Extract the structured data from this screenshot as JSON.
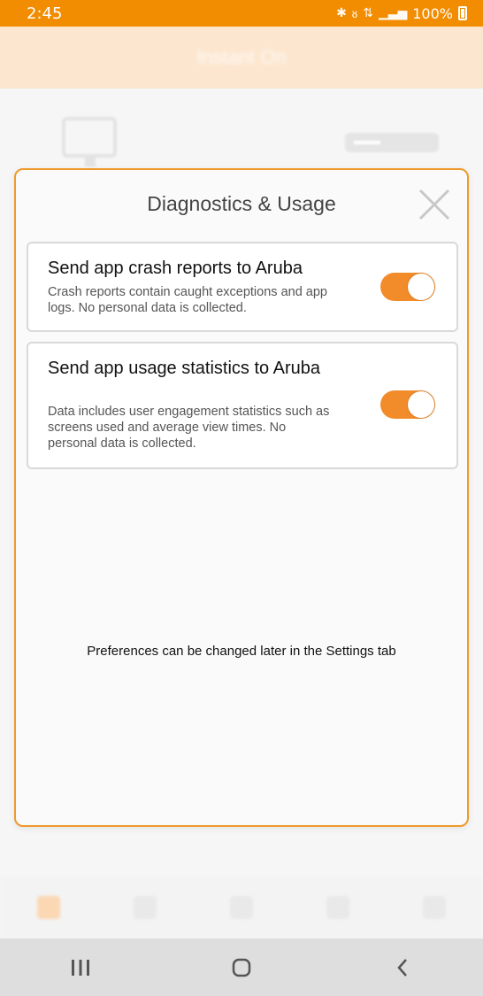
{
  "status_bar": {
    "time": "2:45",
    "battery_text": "100%",
    "icons": [
      "bluetooth-icon",
      "mute-icon",
      "data-icon",
      "signal-icon",
      "battery-icon"
    ]
  },
  "background_app": {
    "header_title": "Instant On",
    "accent": "#f28c00"
  },
  "modal": {
    "title": "Diagnostics & Usage",
    "close_icon": "close-icon",
    "options": [
      {
        "title": "Send app crash reports to Aruba",
        "description": "Crash reports contain caught exceptions and app logs. No personal data is collected.",
        "enabled": true
      },
      {
        "title": "Send app usage statistics to Aruba",
        "description": "Data includes user engagement statistics such as screens used and average view times. No personal data is collected.",
        "enabled": true
      }
    ],
    "footer_note": "Preferences can be changed later in the Settings tab"
  },
  "nav_bar": {
    "buttons": [
      "recents-icon",
      "home-icon",
      "back-icon"
    ]
  },
  "colors": {
    "status_bar": "#f28c00",
    "toggle_on": "#f28c2a",
    "modal_border": "#ee9a2c"
  }
}
